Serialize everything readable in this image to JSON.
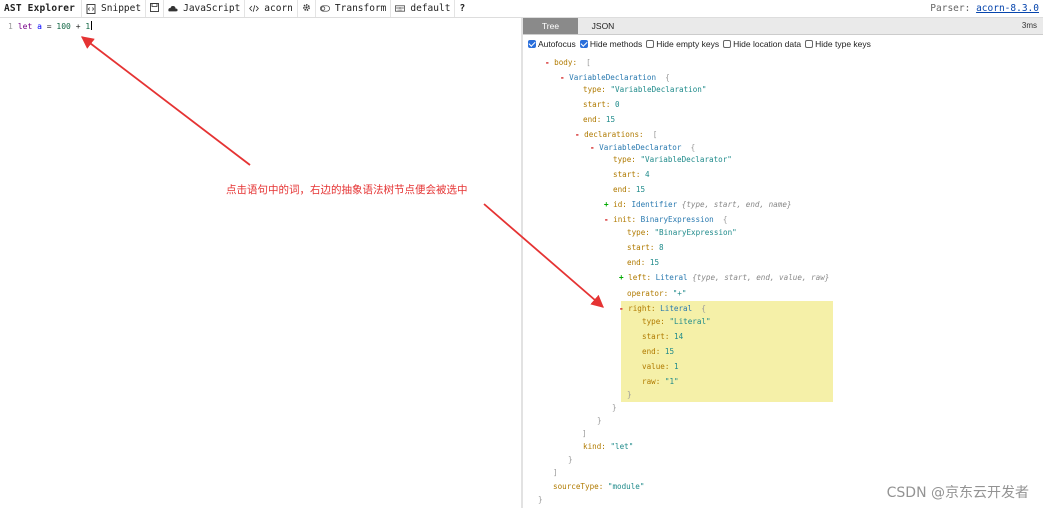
{
  "toolbar": {
    "app_title": "AST Explorer",
    "snippet_label": "Snippet",
    "language_label": "JavaScript",
    "parser_label": "acorn",
    "transform_label": "Transform",
    "keymap_label": "default",
    "help_label": "?",
    "parser_prefix": "Parser:",
    "parser_link": "acorn-8.3.0"
  },
  "editor": {
    "line_number": "1",
    "kw": "let",
    "ident": "a",
    "eq": "=",
    "num1": "100",
    "plus": "+",
    "num2": "1"
  },
  "panel": {
    "tabs": [
      "Tree",
      "JSON"
    ],
    "timing": "3ms",
    "options": [
      {
        "label": "Autofocus",
        "checked": true
      },
      {
        "label": "Hide methods",
        "checked": true
      },
      {
        "label": "Hide empty keys",
        "checked": false
      },
      {
        "label": "Hide location data",
        "checked": false
      },
      {
        "label": "Hide type keys",
        "checked": false
      }
    ]
  },
  "tree": {
    "minus": "-",
    "plus": "+",
    "body_key": "body:",
    "open_bracket": "[",
    "close_bracket": "]",
    "open_brace": "{",
    "close_brace": "}",
    "var_decl_type": "VariableDeclaration",
    "type_key": "type:",
    "start_key": "start:",
    "end_key": "end:",
    "kind_key": "kind:",
    "declarations_key": "declarations:",
    "value_key": "value:",
    "raw_key": "raw:",
    "operator_key": "operator:",
    "sourcetype_key": "sourceType:",
    "var_decl_type_str": "\"VariableDeclaration\"",
    "var_decl_start": "0",
    "var_decl_end": "15",
    "declarator_type": "VariableDeclarator",
    "declarator_type_str": "\"VariableDeclarator\"",
    "declarator_start": "4",
    "declarator_end": "15",
    "id_key": "id:",
    "id_type": "Identifier",
    "id_summary": "{type, start, end, name}",
    "init_key": "init:",
    "init_type": "BinaryExpression",
    "init_type_str": "\"BinaryExpression\"",
    "init_start": "8",
    "init_end": "15",
    "left_key": "left:",
    "left_type": "Literal",
    "left_summary": "{type, start, end, value, raw}",
    "operator_val": "\"+\"",
    "right_key": "right:",
    "right_type": "Literal",
    "right_type_str": "\"Literal\"",
    "right_start": "14",
    "right_end": "15",
    "right_value": "1",
    "right_raw": "\"1\"",
    "kind_val": "\"let\"",
    "sourcetype_val": "\"module\""
  },
  "annotation": {
    "text": "点击语句中的词，右边的抽象语法树节点便会被选中",
    "color": "#e53333"
  },
  "watermark": "CSDN @京东云开发者"
}
